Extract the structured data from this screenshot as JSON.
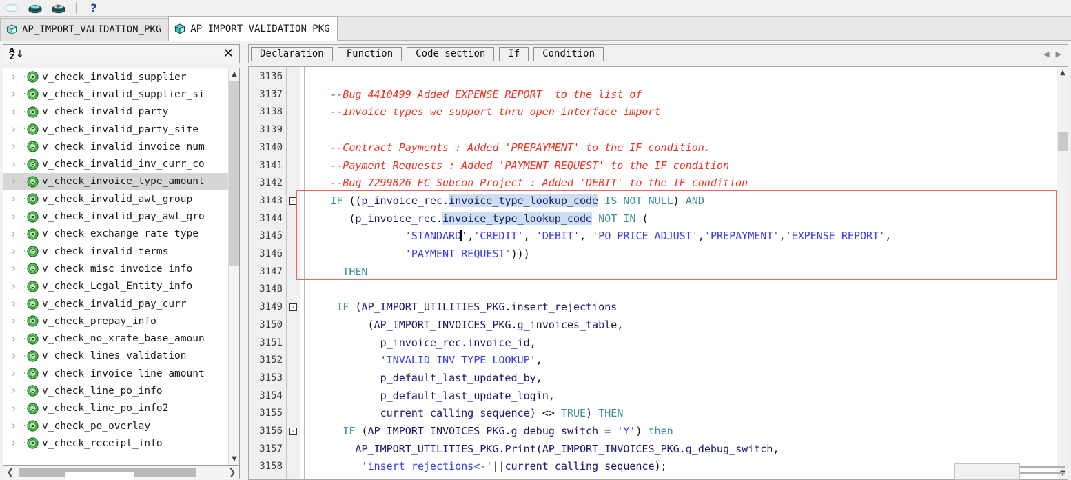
{
  "toolbar": {
    "buttons": [
      {
        "name": "save-icon",
        "label": ""
      },
      {
        "name": "save-all-icon",
        "label": ""
      },
      {
        "name": "save-with-error-icon",
        "label": ""
      }
    ],
    "help_label": "?"
  },
  "tabs": [
    {
      "label": "AP_IMPORT_VALIDATION_PKG",
      "icon": "package-cube-icon",
      "active": false
    },
    {
      "label": "AP_IMPORT_VALIDATION_PKG",
      "icon": "package-cube-icon",
      "active": true
    }
  ],
  "sidebar": {
    "sort_icon": "sort-az-icon",
    "sort_letters": [
      "A",
      "Z"
    ],
    "close_label": "✕",
    "items": [
      {
        "label": "v_check_invalid_supplier",
        "selected": false
      },
      {
        "label": "v_check_invalid_supplier_si",
        "selected": false
      },
      {
        "label": "v_check_invalid_party",
        "selected": false
      },
      {
        "label": "v_check_invalid_party_site",
        "selected": false
      },
      {
        "label": "v_check_invalid_invoice_num",
        "selected": false
      },
      {
        "label": "v_check_invalid_inv_curr_co",
        "selected": false
      },
      {
        "label": "v_check_invoice_type_amount",
        "selected": true
      },
      {
        "label": "v_check_invalid_awt_group",
        "selected": false
      },
      {
        "label": "v_check_invalid_pay_awt_gro",
        "selected": false
      },
      {
        "label": "v_check_exchange_rate_type",
        "selected": false
      },
      {
        "label": "v_check_invalid_terms",
        "selected": false
      },
      {
        "label": "v_check_misc_invoice_info",
        "selected": false
      },
      {
        "label": "v_check_Legal_Entity_info",
        "selected": false
      },
      {
        "label": "v_check_invalid_pay_curr",
        "selected": false
      },
      {
        "label": "v_check_prepay_info",
        "selected": false
      },
      {
        "label": "v_check_no_xrate_base_amoun",
        "selected": false
      },
      {
        "label": "v_check_lines_validation",
        "selected": false
      },
      {
        "label": "v_check_invoice_line_amount",
        "selected": false
      },
      {
        "label": "v_check_line_po_info",
        "selected": false
      },
      {
        "label": "v_check_line_po_info2",
        "selected": false
      },
      {
        "label": "v_check_po_overlay",
        "selected": false
      },
      {
        "label": "v_check_receipt_info",
        "selected": false
      }
    ]
  },
  "navbar": {
    "buttons": [
      "Declaration",
      "Function",
      "Code section",
      "If",
      "Condition"
    ],
    "scroll_left": "◀",
    "scroll_right": "▶"
  },
  "editor": {
    "first_line_number": 3136,
    "lines": [
      {
        "n": 3136,
        "fold": "",
        "text": ""
      },
      {
        "n": 3137,
        "fold": "",
        "text": "    --Bug 4410499 Added EXPENSE REPORT  to the list of"
      },
      {
        "n": 3138,
        "fold": "",
        "text": "    --invoice types we support thru open interface import"
      },
      {
        "n": 3139,
        "fold": "",
        "text": ""
      },
      {
        "n": 3140,
        "fold": "",
        "text": "    --Contract Payments : Added 'PREPAYMENT' to the IF condition."
      },
      {
        "n": 3141,
        "fold": "",
        "text": "    --Payment Requests : Added 'PAYMENT REQUEST' to the IF condition"
      },
      {
        "n": 3142,
        "fold": "",
        "text": "    --Bug 7299826 EC Subcon Project : Added 'DEBIT' to the IF condition"
      },
      {
        "n": 3143,
        "fold": "-",
        "text": "    IF ((p_invoice_rec.invoice_type_lookup_code IS NOT NULL) AND"
      },
      {
        "n": 3144,
        "fold": "",
        "text": "       (p_invoice_rec.invoice_type_lookup_code NOT IN ("
      },
      {
        "n": 3145,
        "fold": "",
        "text": "                'STANDARD','CREDIT', 'DEBIT', 'PO PRICE ADJUST','PREPAYMENT','EXPENSE REPORT',"
      },
      {
        "n": 3146,
        "fold": "",
        "text": "                'PAYMENT REQUEST')))"
      },
      {
        "n": 3147,
        "fold": "",
        "text": "      THEN"
      },
      {
        "n": 3148,
        "fold": "",
        "text": ""
      },
      {
        "n": 3149,
        "fold": "-",
        "text": "     IF (AP_IMPORT_UTILITIES_PKG.insert_rejections"
      },
      {
        "n": 3150,
        "fold": "",
        "text": "          (AP_IMPORT_INVOICES_PKG.g_invoices_table,"
      },
      {
        "n": 3151,
        "fold": "",
        "text": "            p_invoice_rec.invoice_id,"
      },
      {
        "n": 3152,
        "fold": "",
        "text": "            'INVALID INV TYPE LOOKUP',"
      },
      {
        "n": 3153,
        "fold": "",
        "text": "            p_default_last_updated_by,"
      },
      {
        "n": 3154,
        "fold": "",
        "text": "            p_default_last_update_login,"
      },
      {
        "n": 3155,
        "fold": "",
        "text": "            current_calling_sequence) <> TRUE) THEN"
      },
      {
        "n": 3156,
        "fold": "-",
        "text": "      IF (AP_IMPORT_INVOICES_PKG.g_debug_switch = 'Y') then"
      },
      {
        "n": 3157,
        "fold": "",
        "text": "        AP_IMPORT_UTILITIES_PKG.Print(AP_IMPORT_INVOICES_PKG.g_debug_switch,"
      },
      {
        "n": 3158,
        "fold": "",
        "text": "         'insert_rejections<-'||current_calling_sequence);"
      }
    ],
    "highlight_box": {
      "color": "#e8665c",
      "covers_lines": [
        3143,
        3146
      ]
    },
    "selection_text": "invoice_type",
    "caret_after": "'STANDARD"
  },
  "colors": {
    "comment": "#ee3322",
    "keyword": "#3d8f99",
    "string": "#3a3af0",
    "identifier": "#1a1a6e",
    "selection": "#cdddf2",
    "highlight_border": "#e8665c",
    "tree_selection": "#d6d6d6"
  }
}
